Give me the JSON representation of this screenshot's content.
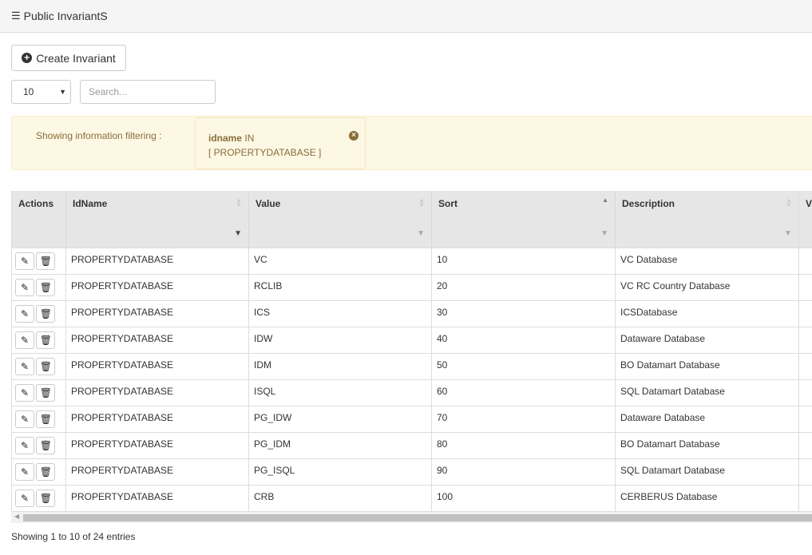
{
  "header": {
    "title": "Public InvariantS",
    "icon": "list-icon"
  },
  "toolbar": {
    "create_label": "Create Invariant"
  },
  "length_select": {
    "value": "10"
  },
  "search": {
    "placeholder": "Search...",
    "value": ""
  },
  "filter": {
    "label": "Showing information filtering :",
    "field": "idname",
    "operator": "IN",
    "values": "[ PROPERTYDATABASE ]"
  },
  "table": {
    "columns": [
      "Actions",
      "IdName",
      "Value",
      "Sort",
      "Description",
      "Ve"
    ],
    "rows": [
      [
        "PROPERTYDATABASE",
        "VC",
        "10",
        "VC Database"
      ],
      [
        "PROPERTYDATABASE",
        "RCLIB",
        "20",
        "VC RC Country Database"
      ],
      [
        "PROPERTYDATABASE",
        "ICS",
        "30",
        "ICSDatabase"
      ],
      [
        "PROPERTYDATABASE",
        "IDW",
        "40",
        "Dataware Database"
      ],
      [
        "PROPERTYDATABASE",
        "IDM",
        "50",
        "BO Datamart Database"
      ],
      [
        "PROPERTYDATABASE",
        "ISQL",
        "60",
        "SQL Datamart Database"
      ],
      [
        "PROPERTYDATABASE",
        "PG_IDW",
        "70",
        "Dataware Database"
      ],
      [
        "PROPERTYDATABASE",
        "PG_IDM",
        "80",
        "BO Datamart Database"
      ],
      [
        "PROPERTYDATABASE",
        "PG_ISQL",
        "90",
        "SQL Datamart Database"
      ],
      [
        "PROPERTYDATABASE",
        "CRB",
        "100",
        "CERBERUS Database"
      ]
    ]
  },
  "footer": {
    "info": "Showing 1 to 10 of 24 entries"
  }
}
